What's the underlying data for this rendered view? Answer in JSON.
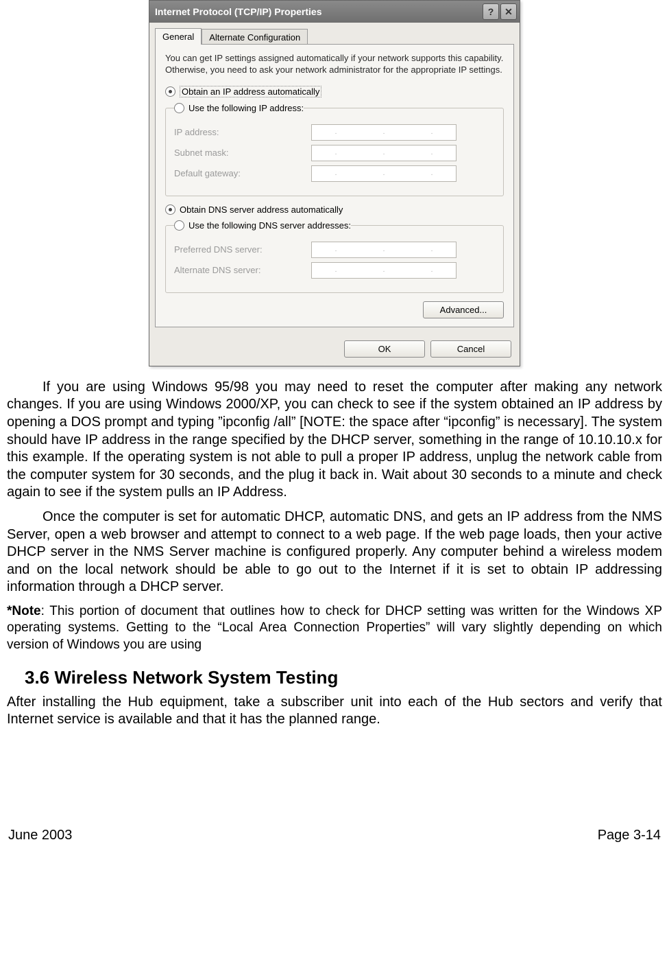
{
  "dialog": {
    "title": "Internet Protocol (TCP/IP) Properties",
    "help_glyph": "?",
    "close_glyph": "✕",
    "tabs": {
      "general": "General",
      "alternate": "Alternate Configuration"
    },
    "description": "You can get IP settings assigned automatically if your network supports this capability. Otherwise, you need to ask your network administrator for the appropriate IP settings.",
    "radio_auto_ip": "Obtain an IP address automatically",
    "radio_manual_ip": "Use the following IP address:",
    "ip_address_label": "IP address:",
    "subnet_label": "Subnet mask:",
    "gateway_label": "Default gateway:",
    "radio_auto_dns": "Obtain DNS server address automatically",
    "radio_manual_dns": "Use the following DNS server addresses:",
    "pref_dns_label": "Preferred DNS server:",
    "alt_dns_label": "Alternate DNS server:",
    "advanced_btn": "Advanced...",
    "ok_btn": "OK",
    "cancel_btn": "Cancel"
  },
  "doc": {
    "p1": "If you are using Windows 95/98 you may need to reset the computer after making any network changes. If you are using Windows 2000/XP, you can check to see if the system obtained an IP address by opening a DOS prompt and typing ”ipconfig /all” [NOTE: the space after “ipconfig” is necessary].  The system should have IP address in the range specified by the DHCP server, something in the range of 10.10.10.x for this example.  If the operating system is not able to pull a proper IP address, unplug the network cable from the computer system for 30 seconds, and the plug it back in. Wait about 30 seconds to a minute and check again to see if the system pulls an IP Address.",
    "p2": "Once the computer is set for automatic DHCP, automatic DNS, and gets an IP address from the NMS Server, open a web browser and attempt to connect to a web page. If the web page loads, then your active DHCP server in the NMS Server machine is configured properly. Any computer behind a wireless modem and on the local network should be able to go out to the Internet if it is set to obtain IP addressing information through a DHCP server.",
    "note_label": "*Note",
    "note_body": ": This portion of document that outlines how to check for DHCP setting was written for the Windows XP operating systems.  Getting to the “Local Area Connection Properties” will vary slightly depending on which version of Windows you are using",
    "heading": "3.6    Wireless Network System Testing",
    "p3": "After installing the Hub equipment, take a subscriber unit into each of the Hub sectors and verify that Internet service is available and that it has the planned range.",
    "footer_left": "June 2003",
    "footer_right": "Page 3-14"
  }
}
